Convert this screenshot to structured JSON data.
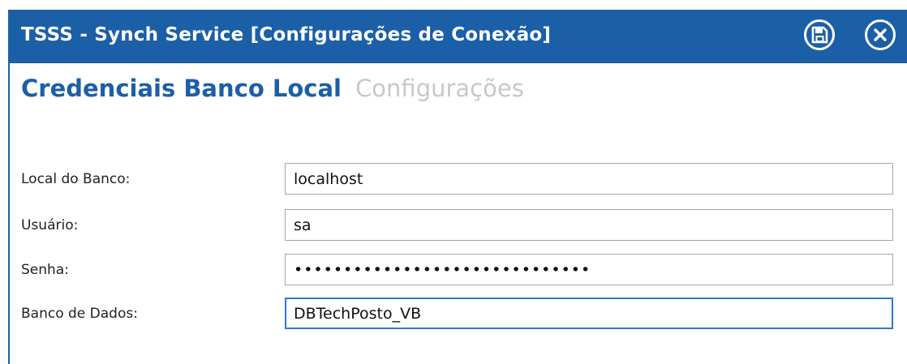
{
  "window": {
    "title": "TSSS - Synch Service [Configurações de Conexão]",
    "accent_color": "#1b5fa7",
    "save_icon": "floppy-disk-icon",
    "close_icon": "close-icon"
  },
  "tabs": [
    {
      "label": "Credenciais Banco Local",
      "active": true
    },
    {
      "label": "Configurações",
      "active": false
    }
  ],
  "form": {
    "local_do_banco": {
      "label": "Local do Banco:",
      "value": "localhost"
    },
    "usuario": {
      "label": "Usuário:",
      "value": "sa"
    },
    "senha": {
      "label": "Senha:",
      "value": "••••••••••••••••••••••••••••••"
    },
    "banco_de_dados": {
      "label": "Banco de Dados:",
      "value": "DBTechPosto_VB"
    }
  }
}
